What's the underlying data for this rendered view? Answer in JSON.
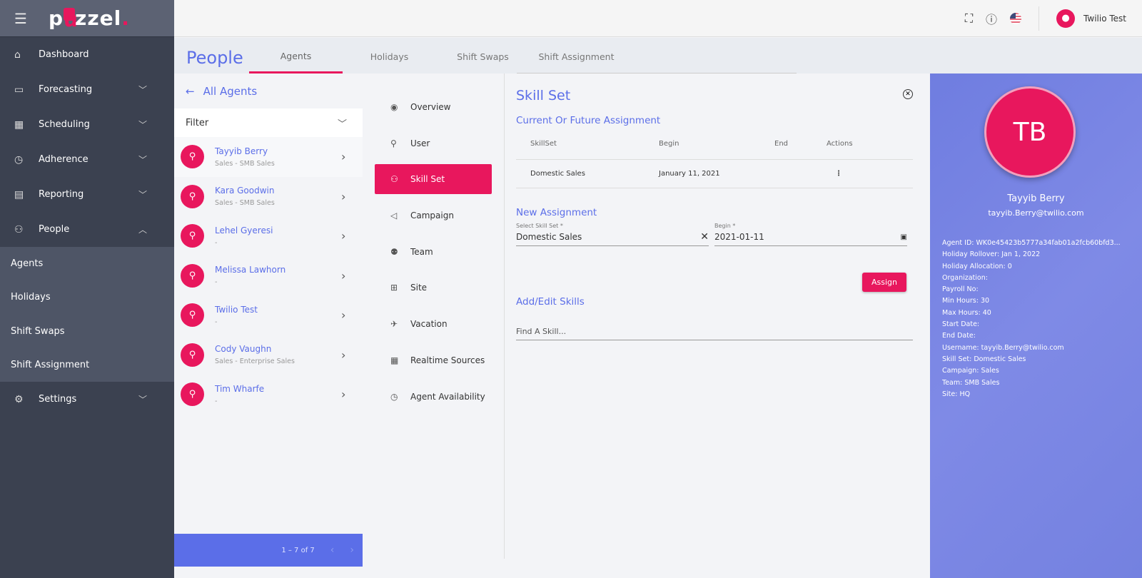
{
  "sidebar": {
    "logo": "puzzel",
    "items": [
      {
        "label": "Dashboard",
        "icon": "home-icon"
      },
      {
        "label": "Forecasting",
        "icon": "chart-icon"
      },
      {
        "label": "Scheduling",
        "icon": "calendar-icon"
      },
      {
        "label": "Adherence",
        "icon": "watch-icon"
      },
      {
        "label": "Reporting",
        "icon": "report-icon"
      },
      {
        "label": "People",
        "icon": "people-icon"
      }
    ],
    "sub_items": [
      "Agents",
      "Holidays",
      "Shift Swaps",
      "Shift Assignment"
    ],
    "settings": "Settings"
  },
  "topbar": {
    "user": "Twilio Test"
  },
  "page": {
    "title": "People",
    "tabs": [
      "Agents",
      "Holidays",
      "Shift Swaps",
      "Shift Assignment"
    ]
  },
  "agents": {
    "back": "All Agents",
    "filter": "Filter",
    "pagination": "1 – 7 of 7",
    "list": [
      {
        "name": "Tayyib Berry",
        "sub": "Sales - SMB Sales"
      },
      {
        "name": "Kara Goodwin",
        "sub": "Sales - SMB Sales"
      },
      {
        "name": "Lehel Gyeresi",
        "sub": "-"
      },
      {
        "name": "Melissa Lawhorn",
        "sub": "-"
      },
      {
        "name": "Twilio Test",
        "sub": "-"
      },
      {
        "name": "Cody Vaughn",
        "sub": "Sales - Enterprise Sales"
      },
      {
        "name": "Tim Wharfe",
        "sub": "-"
      }
    ]
  },
  "menu": [
    "Overview",
    "User",
    "Skill Set",
    "Campaign",
    "Team",
    "Site",
    "Vacation",
    "Realtime Sources",
    "Agent Availability"
  ],
  "skillset": {
    "title": "Skill Set",
    "current": "Current Or Future Assignment",
    "columns": [
      "SkillSet",
      "Begin",
      "End",
      "Actions"
    ],
    "rows": [
      {
        "skillset": "Domestic Sales",
        "begin": "January 11, 2021",
        "end": ""
      }
    ],
    "new": "New Assignment",
    "select_label": "Select Skill Set *",
    "select_value": "Domestic Sales",
    "begin_label": "Begin *",
    "begin_value": "2021-01-11",
    "assign": "Assign",
    "add_edit": "Add/Edit Skills",
    "find_placeholder": "Find A Skill..."
  },
  "profile": {
    "initials": "TB",
    "name": "Tayyib Berry",
    "email": "tayyib.Berry@twilio.com",
    "details": [
      {
        "k": "Agent ID:",
        "v": "WK0e45423b5777a34fab01a2fcb60bfd3..."
      },
      {
        "k": "Holiday Rollover:",
        "v": "Jan 1, 2022"
      },
      {
        "k": "Holiday Allocation:",
        "v": "0"
      },
      {
        "k": "Organization:",
        "v": ""
      },
      {
        "k": "Payroll No:",
        "v": ""
      },
      {
        "k": "Min Hours:",
        "v": "30"
      },
      {
        "k": "Max Hours:",
        "v": "40"
      },
      {
        "k": "Start Date:",
        "v": ""
      },
      {
        "k": "End Date:",
        "v": ""
      },
      {
        "k": "Username:",
        "v": "tayyib.Berry@twilio.com"
      },
      {
        "k": "Skill Set:",
        "v": "Domestic Sales"
      },
      {
        "k": "Campaign:",
        "v": "Sales"
      },
      {
        "k": "Team:",
        "v": "SMB Sales"
      },
      {
        "k": "Site:",
        "v": "HQ"
      }
    ]
  },
  "colors": {
    "accent": "#e8175d",
    "primary": "#5b6ee8",
    "sidebar": "#3b4150"
  }
}
